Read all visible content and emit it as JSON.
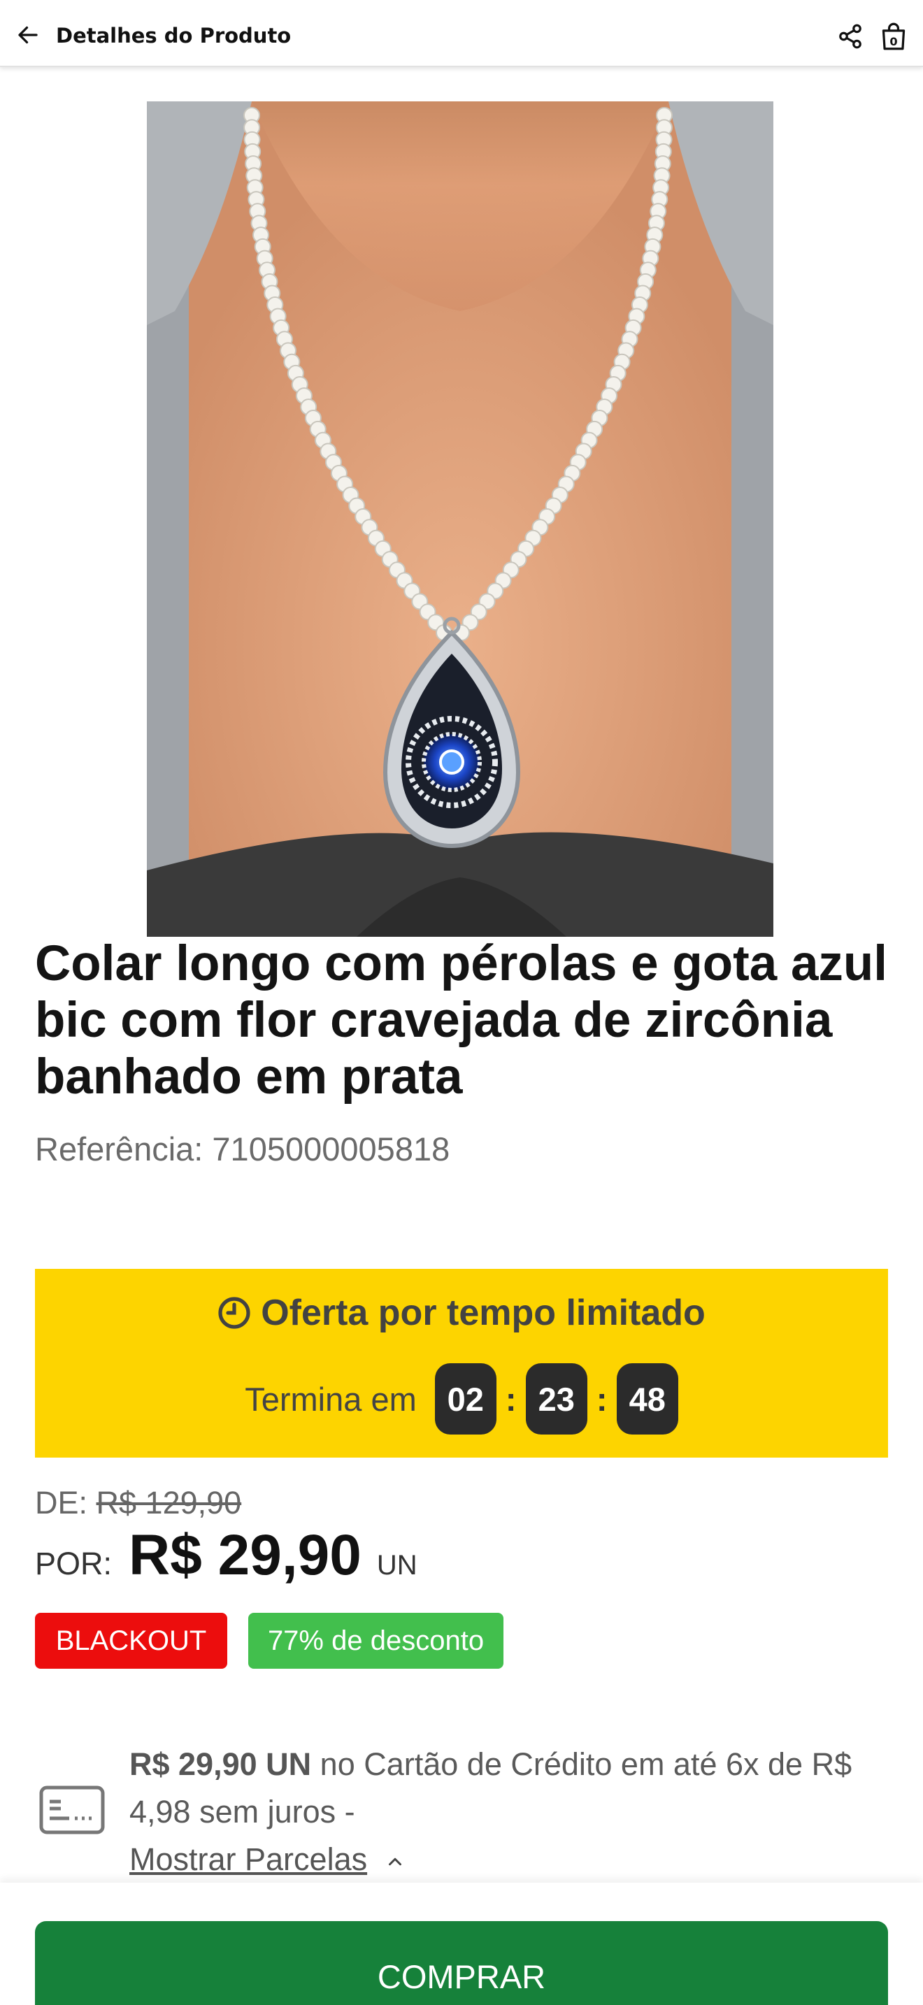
{
  "header": {
    "title": "Detalhes do Produto",
    "back_icon": "arrow-left-icon",
    "share_icon": "share-icon",
    "bag_icon": "shopping-bag-icon",
    "bag_count": "0"
  },
  "product": {
    "image_description": "pearl-necklace-with-blue-pendant",
    "title": "Colar longo com pérolas e gota azul bic com flor cravejada de zircônia banhado em prata",
    "reference_label": "Referência:",
    "reference_value": "7105000005818"
  },
  "offer": {
    "icon": "clock-icon",
    "heading": "Oferta por tempo limitado",
    "ends_label": "Termina em",
    "hours": "02",
    "minutes": "23",
    "seconds": "48",
    "separator": ":",
    "background_color": "#fdd400"
  },
  "pricing": {
    "de_label": "DE:",
    "old_price": "R$ 129,90",
    "por_label": "POR:",
    "price": "R$ 29,90",
    "unit": "UN"
  },
  "badges": {
    "blackout": "BLACKOUT",
    "discount": "77% de desconto",
    "blackout_color": "#ec0d0d",
    "discount_color": "#42bf4d"
  },
  "installments": {
    "icon": "credit-card-icon",
    "price": "R$ 29,90",
    "unit": "UN",
    "text": "no Cartão de Crédito em até 6x de R$ 4,98 sem juros -",
    "link": "Mostrar Parcelas",
    "link_icon": "chevron-up-icon"
  },
  "footer": {
    "buy_label": "COMPRAR",
    "buy_color": "#16813a"
  }
}
